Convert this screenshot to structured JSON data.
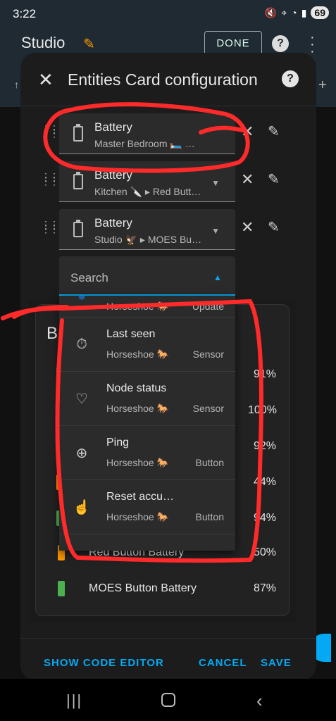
{
  "status_bar": {
    "time": "3:22",
    "battery": "69",
    "icons": [
      "mute-icon",
      "location-icon",
      "wifi-icon",
      "signal-icon"
    ]
  },
  "app_bar": {
    "title": "Studio",
    "done_label": "DONE"
  },
  "dialog": {
    "title": "Entities Card configuration",
    "entities": [
      {
        "title": "Battery",
        "subtitle": "Master Bedroom 🛏️ …"
      },
      {
        "title": "Battery",
        "subtitle": "Kitchen 🔪 ▸ Red Butt…"
      },
      {
        "title": "Battery",
        "subtitle": "Studio 🦅 ▸ MOES Bu…"
      }
    ],
    "search": {
      "label": "Search"
    },
    "dropdown": {
      "partial_top": {
        "sub": "Horseshoe 🐎",
        "type": "Update"
      },
      "items": [
        {
          "title": "Last seen",
          "sub": "Horseshoe 🐎",
          "type": "Sensor",
          "icon": "timer-icon"
        },
        {
          "title": "Node status",
          "sub": "Horseshoe 🐎",
          "type": "Sensor",
          "icon": "heart-pulse-icon"
        },
        {
          "title": "Ping",
          "sub": "Horseshoe 🐎",
          "type": "Button",
          "icon": "crosshairs-icon"
        },
        {
          "title": "Reset accu…",
          "sub": "Horseshoe 🐎",
          "type": "Button",
          "icon": "gesture-tap-icon"
        }
      ]
    },
    "preview": {
      "header_letter": "B",
      "rows": [
        {
          "value": "91%",
          "color": "#4caf50"
        },
        {
          "value": "100%",
          "color": "#4caf50"
        },
        {
          "value": "92%",
          "color": "#4caf50"
        },
        {
          "value": "44%",
          "color": "#ff9800"
        },
        {
          "value": "94%",
          "color": "#4caf50"
        },
        {
          "name": "Red Button Battery",
          "value": "50%",
          "color": "#ff9800"
        },
        {
          "name": "MOES Button Battery",
          "value": "87%",
          "color": "#4caf50"
        }
      ]
    },
    "footer": {
      "show_code": "SHOW CODE EDITOR",
      "cancel": "CANCEL",
      "save": "SAVE"
    }
  },
  "colors": {
    "accent": "#03a9f4",
    "annotation": "#ff2a2a",
    "warning": "#ff9800",
    "ok": "#4caf50"
  }
}
